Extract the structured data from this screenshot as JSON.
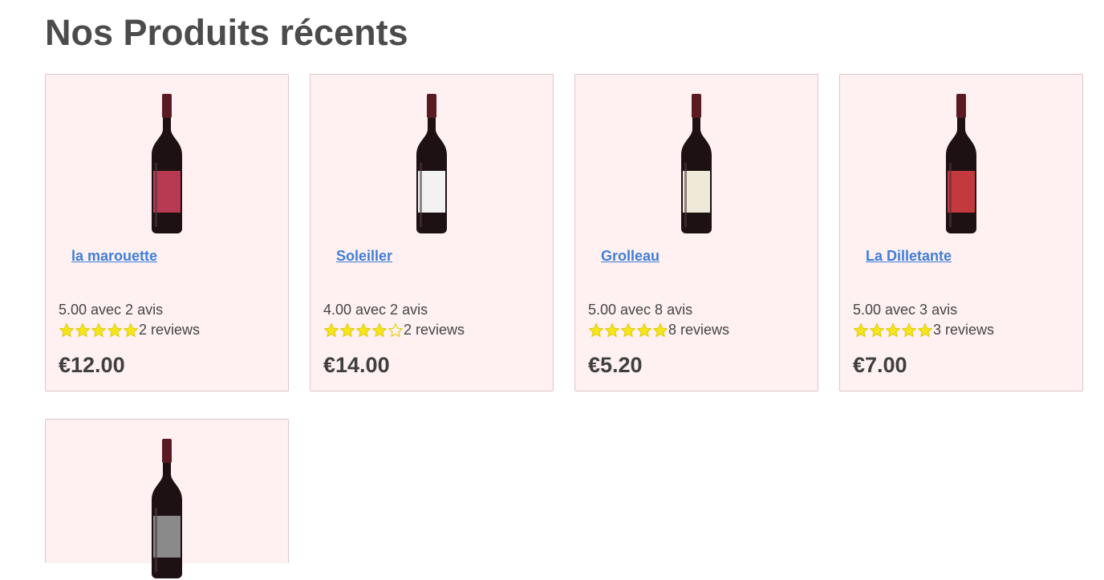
{
  "page": {
    "title": "Nos Produits récents"
  },
  "colors": {
    "card_bg": "#fff0f1",
    "link": "#3f7fd8",
    "star": "#f6e51c"
  },
  "products": [
    {
      "name": "la marouette",
      "average_text": "5.00 avec 2 avis",
      "rating": 5,
      "reviews_text": "2 reviews",
      "price": "€12.00",
      "label_color": "#b73a52",
      "image_icon": "wine-bottle-icon"
    },
    {
      "name": "Soleiller",
      "average_text": "4.00 avec 2 avis",
      "rating": 4,
      "reviews_text": "2 reviews",
      "price": "€14.00",
      "label_color": "#f2f2f2",
      "image_icon": "wine-bottle-icon"
    },
    {
      "name": "Grolleau",
      "average_text": "5.00 avec 8 avis",
      "rating": 5,
      "reviews_text": "8 reviews",
      "price": "€5.20",
      "label_color": "#efe9d8",
      "image_icon": "wine-bottle-icon"
    },
    {
      "name": "La Dilletante",
      "average_text": "5.00 avec 3 avis",
      "rating": 5,
      "reviews_text": "3 reviews",
      "price": "€7.00",
      "label_color": "#c23a3e",
      "image_icon": "wine-bottle-icon"
    },
    {
      "name": "",
      "average_text": "",
      "rating": 0,
      "reviews_text": "",
      "price": "",
      "label_color": "#8a8a8a",
      "image_icon": "wine-bottle-icon"
    }
  ]
}
